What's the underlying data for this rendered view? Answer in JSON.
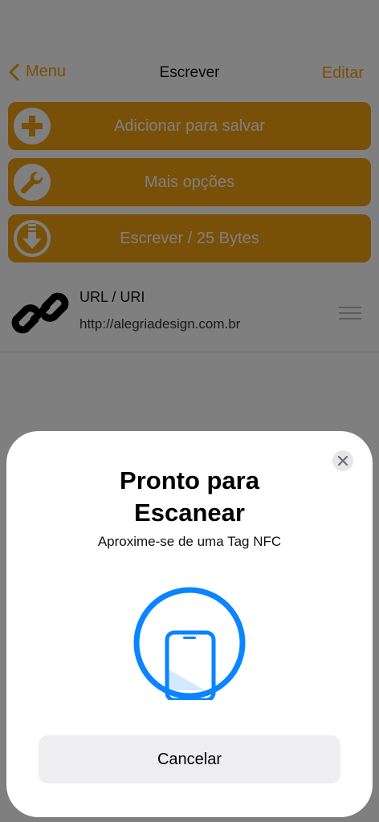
{
  "nav": {
    "back_label": "Menu",
    "title": "Escrever",
    "edit_label": "Editar"
  },
  "actions": [
    {
      "label": "Adicionar para salvar",
      "icon": "plus-circle-icon"
    },
    {
      "label": "Mais opções",
      "icon": "wrench-icon"
    },
    {
      "label": "Escrever / 25 Bytes",
      "icon": "download-circle-icon"
    }
  ],
  "record": {
    "type": "URL / URI",
    "value": "http://alegriadesign.com.br",
    "icon": "link-icon"
  },
  "sheet": {
    "title": "Pronto para Escanear",
    "subtitle": "Aproxime-se de uma Tag NFC",
    "cancel_label": "Cancelar",
    "scan_icon": "phone-scan-icon"
  },
  "colors": {
    "accent": "#f2a10f",
    "scan_blue": "#0a84ff"
  }
}
